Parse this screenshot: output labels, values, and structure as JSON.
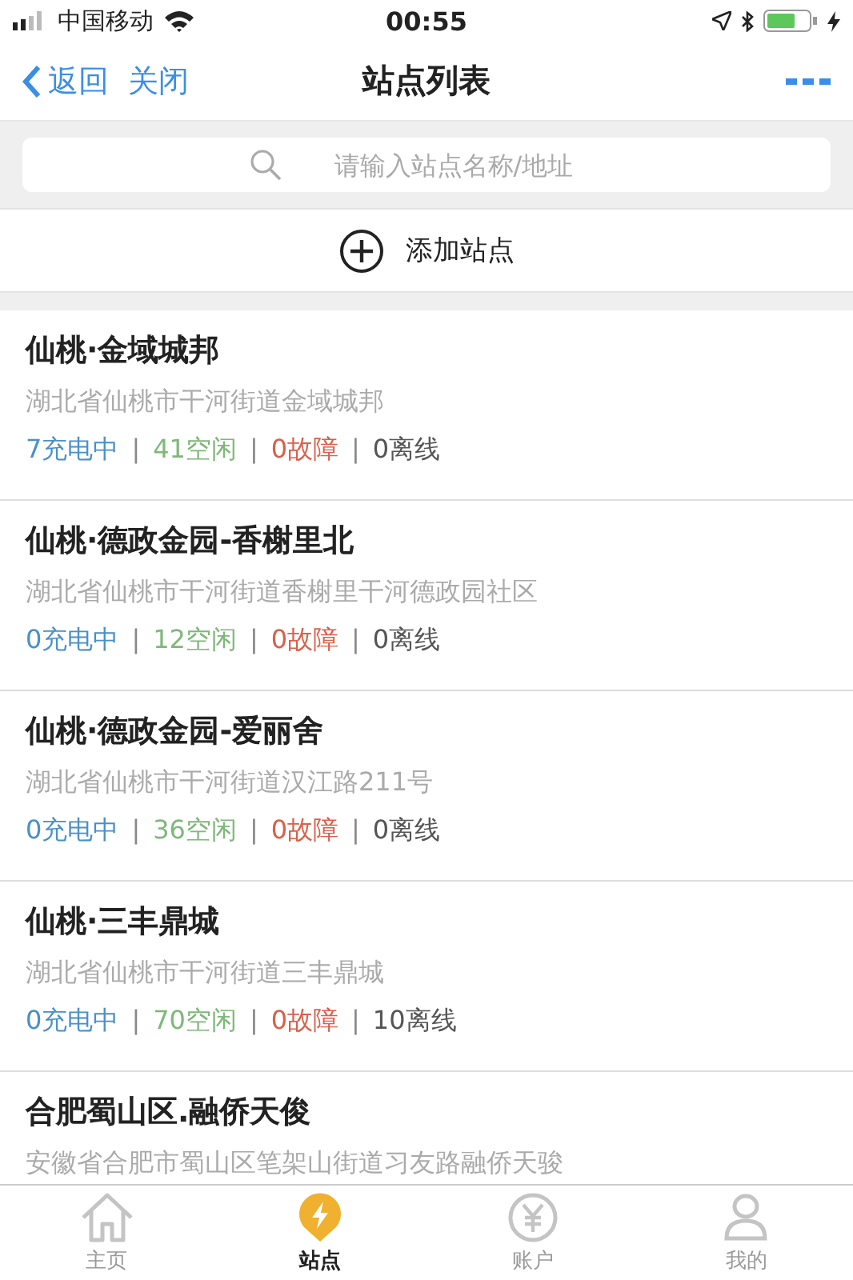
{
  "status_bar": {
    "carrier": "中国移动",
    "time": "00:55"
  },
  "nav": {
    "back": "返回",
    "close": "关闭",
    "title": "站点列表"
  },
  "search": {
    "placeholder": "请输入站点名称/地址"
  },
  "add_button": "添加站点",
  "stations": [
    {
      "name": "仙桃·金域城邦",
      "address": "湖北省仙桃市干河街道金域城邦",
      "stats": [
        {
          "kind": "charging",
          "label": "7充电中"
        },
        {
          "kind": "idle",
          "divider": "|",
          "label": "41空闲"
        },
        {
          "kind": "fault",
          "divider": "|",
          "label": "0故障"
        },
        {
          "kind": "offline",
          "divider": "|",
          "label": "0离线"
        }
      ]
    },
    {
      "name": "仙桃·德政金园-香榭里北",
      "address": "湖北省仙桃市干河街道香榭里干河德政园社区",
      "stats": [
        {
          "kind": "charging",
          "label": "0充电中"
        },
        {
          "kind": "idle",
          "divider": "|",
          "label": "12空闲"
        },
        {
          "kind": "fault",
          "divider": "|",
          "label": "0故障"
        },
        {
          "kind": "offline",
          "divider": "|",
          "label": "0离线"
        }
      ]
    },
    {
      "name": "仙桃·德政金园-爱丽舍",
      "address": "湖北省仙桃市干河街道汉江路211号",
      "stats": [
        {
          "kind": "charging",
          "label": "0充电中"
        },
        {
          "kind": "idle",
          "divider": "|",
          "label": "36空闲"
        },
        {
          "kind": "fault",
          "divider": "|",
          "label": "0故障"
        },
        {
          "kind": "offline",
          "divider": "|",
          "label": "0离线"
        }
      ]
    },
    {
      "name": "仙桃·三丰鼎城",
      "address": "湖北省仙桃市干河街道三丰鼎城",
      "stats": [
        {
          "kind": "charging",
          "label": "0充电中"
        },
        {
          "kind": "idle",
          "divider": "|",
          "label": "70空闲"
        },
        {
          "kind": "fault",
          "divider": "|",
          "label": "0故障"
        },
        {
          "kind": "offline",
          "divider": "|",
          "label": "10离线"
        }
      ]
    },
    {
      "name": "合肥蜀山区.融侨天俊",
      "address": "安徽省合肥市蜀山区笔架山街道习友路融侨天骏"
    }
  ],
  "tabs": [
    {
      "kind": "home",
      "label": "主页",
      "selected": false
    },
    {
      "kind": "station",
      "label": "站点",
      "selected": true
    },
    {
      "kind": "account",
      "label": "账户",
      "selected": false
    },
    {
      "kind": "profile",
      "label": "我的",
      "selected": false
    }
  ]
}
